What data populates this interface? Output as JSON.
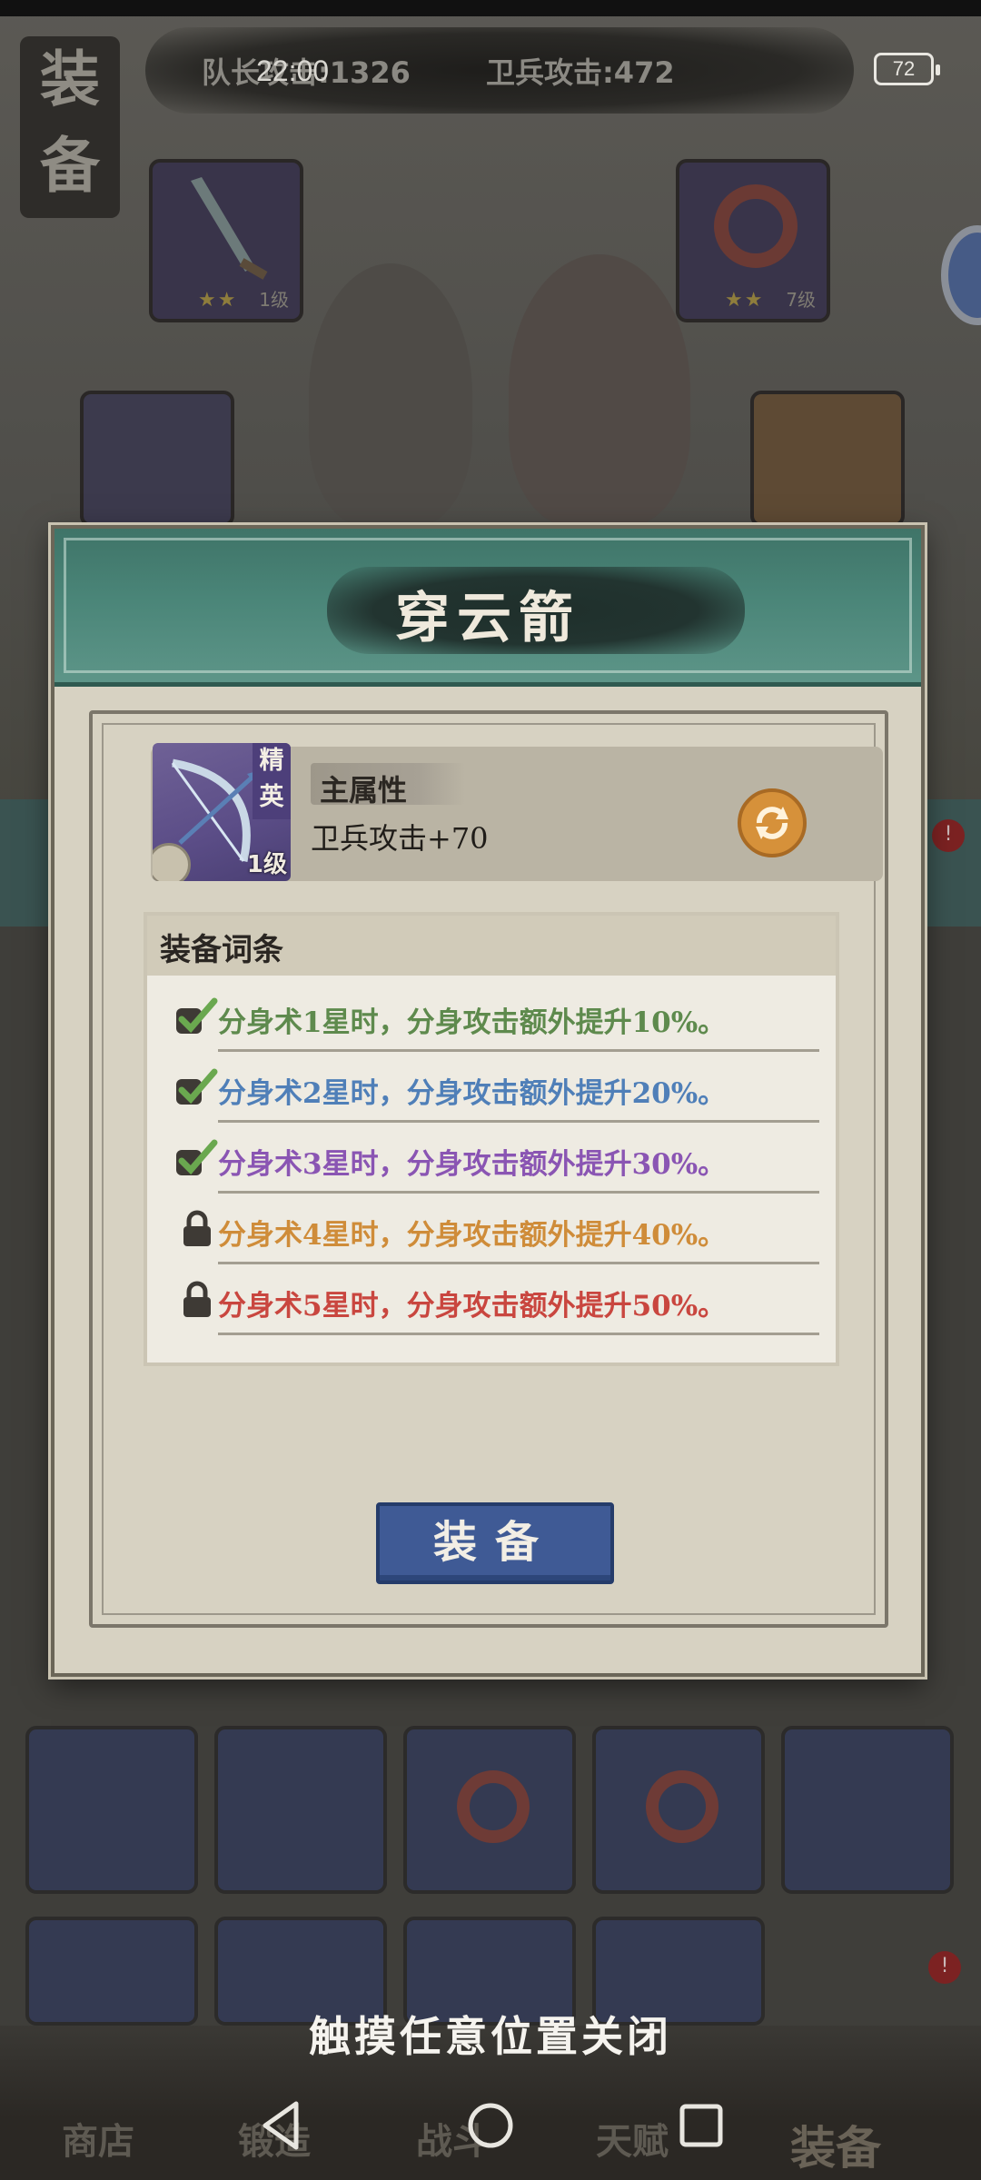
{
  "status_bar": {
    "time": "22:00",
    "battery": "72"
  },
  "header": {
    "captain_attack": "队长攻击:1326",
    "guard_attack": "卫兵攻击:472",
    "side_title": "装备"
  },
  "top_slots": [
    {
      "name": "sword",
      "stars": "★★",
      "level": "1级"
    },
    {
      "name": "whip",
      "stars": "★★",
      "level": "7级"
    }
  ],
  "modal": {
    "title": "穿云箭",
    "item": {
      "grade": "精英",
      "level": "1级",
      "main_attr_label": "主属性",
      "main_attr_value": "卫兵攻击+70"
    },
    "affix_title": "装备词条",
    "affixes": [
      {
        "text": "分身术1星时，分身攻击额外提升10%。",
        "status": "unlocked",
        "color": "#5e8a4d"
      },
      {
        "text": "分身术2星时，分身攻击额外提升20%。",
        "status": "unlocked",
        "color": "#4f7fb8"
      },
      {
        "text": "分身术3星时，分身攻击额外提升30%。",
        "status": "unlocked",
        "color": "#8a55b3"
      },
      {
        "text": "分身术4星时，分身攻击额外提升40%。",
        "status": "locked",
        "color": "#cf8c39"
      },
      {
        "text": "分身术5星时，分身攻击额外提升50%。",
        "status": "locked",
        "color": "#c9463f"
      }
    ],
    "equip_label": "装备"
  },
  "close_hint": "触摸任意位置关闭",
  "bottom_nav": {
    "shop": "商店",
    "forge": "锻造",
    "battle": "战斗",
    "talent": "天赋",
    "equip": "装备"
  },
  "badges": {
    "top_right": "!",
    "bottom_right": "!"
  },
  "colors": {
    "modal_header": "#4a8578",
    "equip_button": "#3f5a95",
    "refresh_button": "#d6913a"
  },
  "icons": {
    "unlocked": "check-icon",
    "locked": "lock-icon",
    "refresh": "refresh-icon",
    "item": "bow-icon"
  }
}
